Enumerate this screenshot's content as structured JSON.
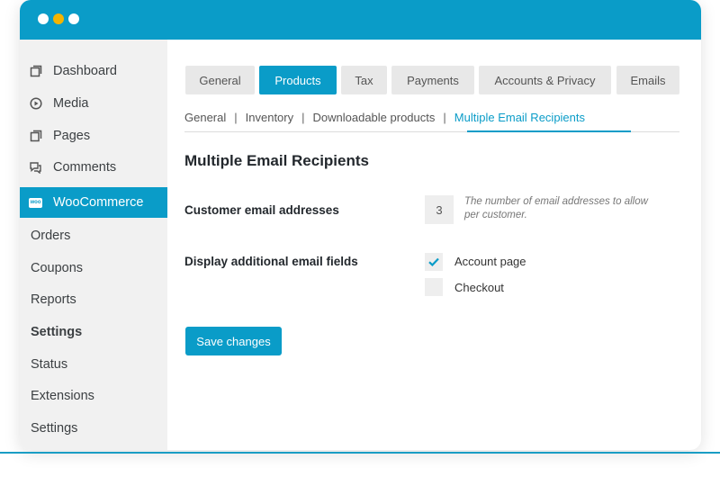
{
  "window": {
    "dots": [
      "close",
      "minimize",
      "maximize"
    ]
  },
  "sidebar": {
    "items": [
      {
        "label": "Dashboard",
        "icon": "dashboard-icon"
      },
      {
        "label": "Media",
        "icon": "media-icon"
      },
      {
        "label": "Pages",
        "icon": "pages-icon"
      },
      {
        "label": "Comments",
        "icon": "comments-icon"
      },
      {
        "label": "WooCommerce",
        "icon": "woocommerce-icon",
        "active": true
      }
    ],
    "subitems": [
      {
        "label": "Orders"
      },
      {
        "label": "Coupons"
      },
      {
        "label": "Reports"
      },
      {
        "label": "Settings",
        "bold": true
      },
      {
        "label": "Status"
      },
      {
        "label": "Extensions"
      },
      {
        "label": "Settings"
      }
    ],
    "woo_badge": "woo"
  },
  "tabs": [
    {
      "label": "General"
    },
    {
      "label": "Products",
      "active": true
    },
    {
      "label": "Tax"
    },
    {
      "label": "Payments"
    },
    {
      "label": "Accounts & Privacy"
    },
    {
      "label": "Emails"
    }
  ],
  "subnav": {
    "items": [
      "General",
      "Inventory",
      "Downloadable products",
      "Multiple Email Recipients"
    ],
    "separator": "|",
    "current": "Multiple Email Recipients"
  },
  "section": {
    "title": "Multiple Email Recipients",
    "fields": {
      "email_addresses": {
        "label": "Customer email addresses",
        "value": "3",
        "help": "The number of email addresses to allow per customer."
      },
      "display_fields": {
        "label": "Display additional email fields",
        "options": [
          {
            "label": "Account page",
            "checked": true
          },
          {
            "label": "Checkout",
            "checked": false
          }
        ]
      }
    }
  },
  "save_label": "Save changes",
  "colors": {
    "accent": "#0a9cc8",
    "yellow_dot": "#f5b400"
  }
}
